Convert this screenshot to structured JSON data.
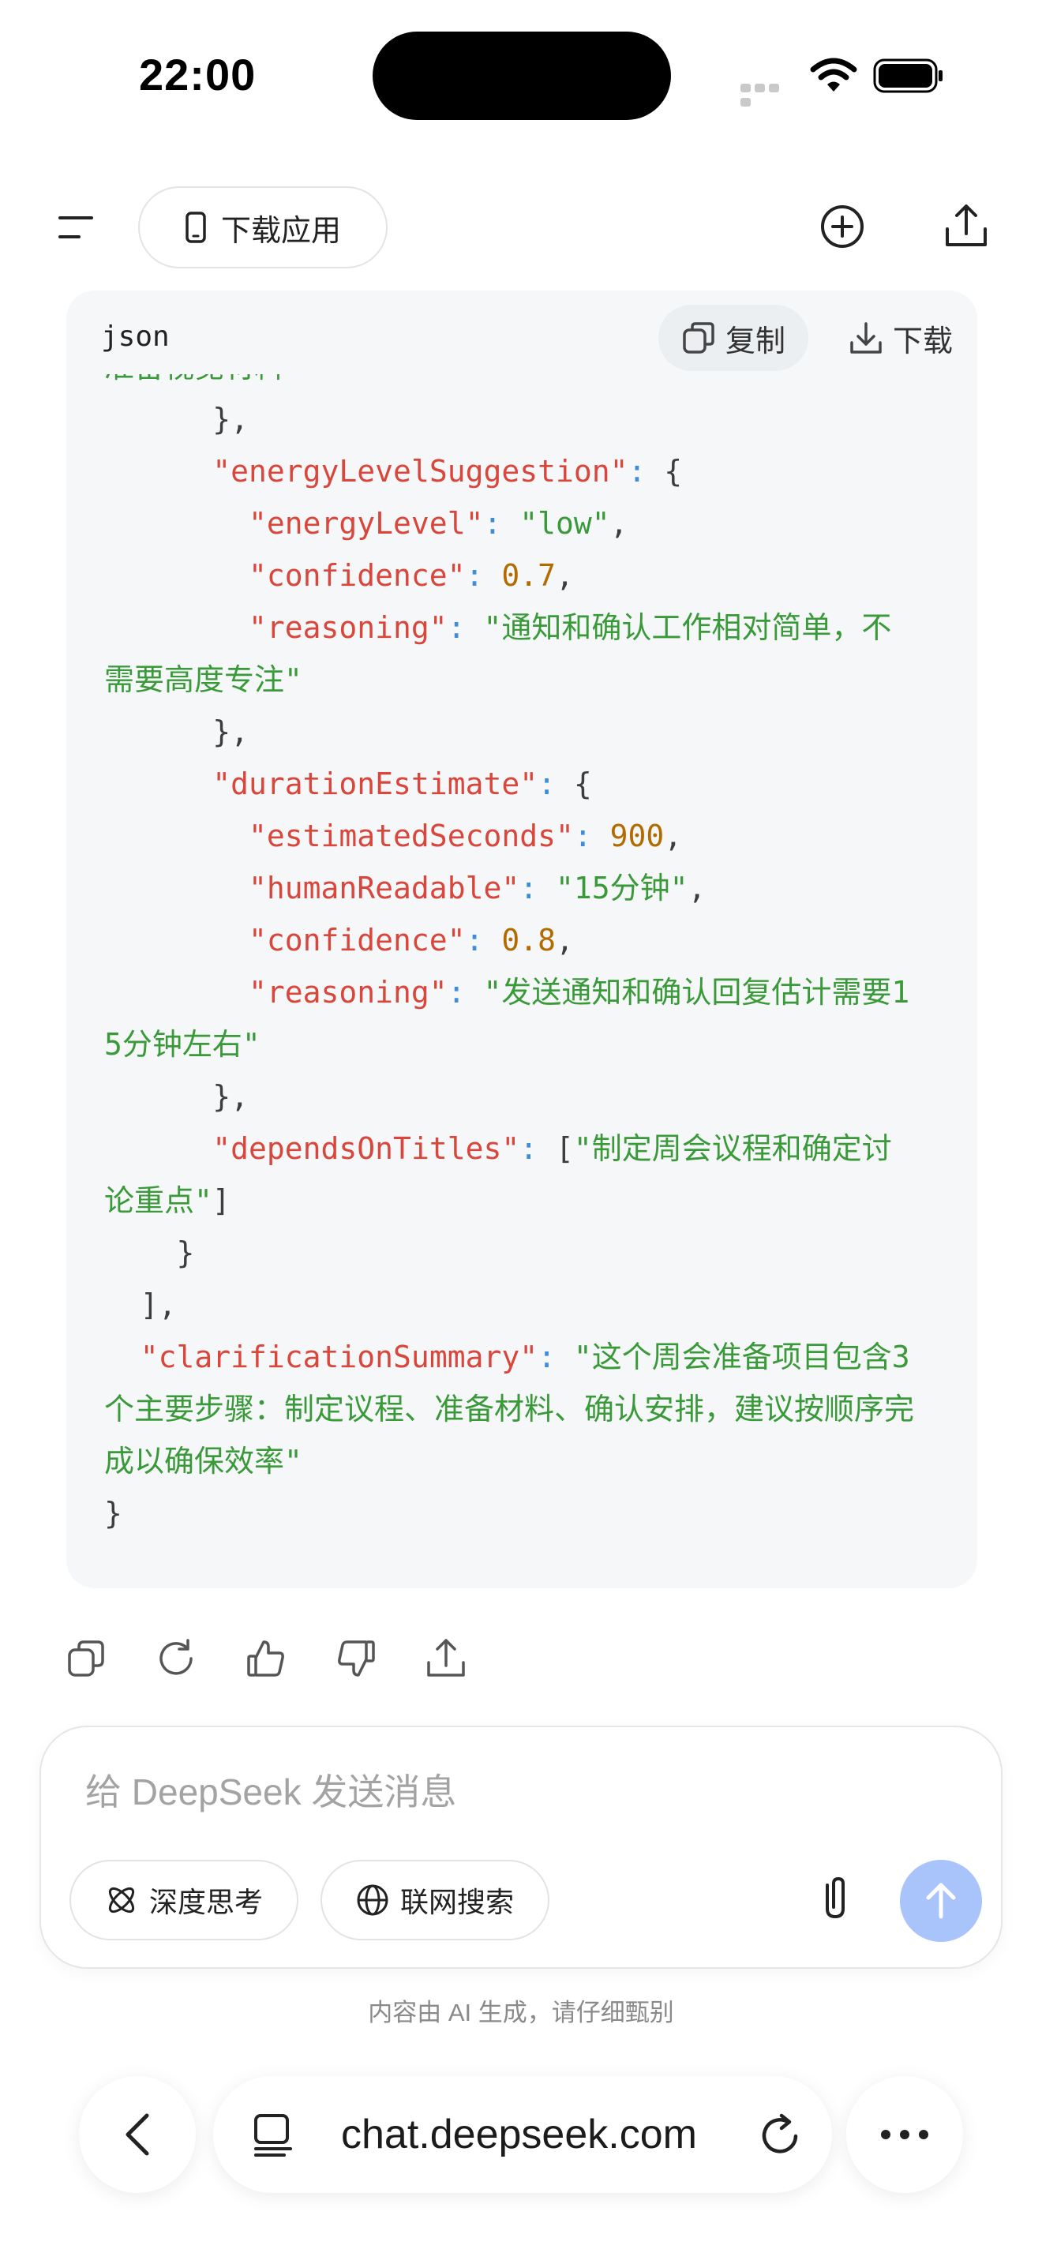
{
  "status_bar": {
    "time": "22:00"
  },
  "top_bar": {
    "download_app_label": "下载应用"
  },
  "code_block": {
    "language": "json",
    "copy_label": "复制",
    "download_label": "下载",
    "lines": [
      [
        {
          "t": "准备视觉材料",
          "c": "s"
        }
      ],
      [
        {
          "t": "      },",
          "c": "p"
        }
      ],
      [
        {
          "t": "      ",
          "c": "p"
        },
        {
          "t": "\"energyLevelSuggestion\"",
          "c": "k"
        },
        {
          "t": ": ",
          "c": "c"
        },
        {
          "t": "{",
          "c": "p"
        }
      ],
      [
        {
          "t": "        ",
          "c": "p"
        },
        {
          "t": "\"energyLevel\"",
          "c": "k"
        },
        {
          "t": ": ",
          "c": "c"
        },
        {
          "t": "\"low\"",
          "c": "s"
        },
        {
          "t": ",",
          "c": "p"
        }
      ],
      [
        {
          "t": "        ",
          "c": "p"
        },
        {
          "t": "\"confidence\"",
          "c": "k"
        },
        {
          "t": ": ",
          "c": "c"
        },
        {
          "t": "0.7",
          "c": "n"
        },
        {
          "t": ",",
          "c": "p"
        }
      ],
      [
        {
          "t": "        ",
          "c": "p"
        },
        {
          "t": "\"reasoning\"",
          "c": "k"
        },
        {
          "t": ": ",
          "c": "c"
        },
        {
          "t": "\"通知和确认工作相对简单，不",
          "c": "s"
        }
      ],
      [
        {
          "t": "需要高度专注\"",
          "c": "s"
        }
      ],
      [
        {
          "t": "      },",
          "c": "p"
        }
      ],
      [
        {
          "t": "      ",
          "c": "p"
        },
        {
          "t": "\"durationEstimate\"",
          "c": "k"
        },
        {
          "t": ": ",
          "c": "c"
        },
        {
          "t": "{",
          "c": "p"
        }
      ],
      [
        {
          "t": "        ",
          "c": "p"
        },
        {
          "t": "\"estimatedSeconds\"",
          "c": "k"
        },
        {
          "t": ": ",
          "c": "c"
        },
        {
          "t": "900",
          "c": "n"
        },
        {
          "t": ",",
          "c": "p"
        }
      ],
      [
        {
          "t": "        ",
          "c": "p"
        },
        {
          "t": "\"humanReadable\"",
          "c": "k"
        },
        {
          "t": ": ",
          "c": "c"
        },
        {
          "t": "\"15分钟\"",
          "c": "s"
        },
        {
          "t": ",",
          "c": "p"
        }
      ],
      [
        {
          "t": "        ",
          "c": "p"
        },
        {
          "t": "\"confidence\"",
          "c": "k"
        },
        {
          "t": ": ",
          "c": "c"
        },
        {
          "t": "0.8",
          "c": "n"
        },
        {
          "t": ",",
          "c": "p"
        }
      ],
      [
        {
          "t": "        ",
          "c": "p"
        },
        {
          "t": "\"reasoning\"",
          "c": "k"
        },
        {
          "t": ": ",
          "c": "c"
        },
        {
          "t": "\"发送通知和确认回复估计需要1",
          "c": "s"
        }
      ],
      [
        {
          "t": "5分钟左右\"",
          "c": "s"
        }
      ],
      [
        {
          "t": "      },",
          "c": "p"
        }
      ],
      [
        {
          "t": "      ",
          "c": "p"
        },
        {
          "t": "\"dependsOnTitles\"",
          "c": "k"
        },
        {
          "t": ": ",
          "c": "c"
        },
        {
          "t": "[",
          "c": "p"
        },
        {
          "t": "\"制定周会议程和确定讨",
          "c": "s"
        }
      ],
      [
        {
          "t": "论重点\"",
          "c": "s"
        },
        {
          "t": "]",
          "c": "p"
        }
      ],
      [
        {
          "t": "    }",
          "c": "p"
        }
      ],
      [
        {
          "t": "  ],",
          "c": "p"
        }
      ],
      [
        {
          "t": "  ",
          "c": "p"
        },
        {
          "t": "\"clarificationSummary\"",
          "c": "k"
        },
        {
          "t": ": ",
          "c": "c"
        },
        {
          "t": "\"这个周会准备项目包含3",
          "c": "s"
        }
      ],
      [
        {
          "t": "个主要步骤：制定议程、准备材料、确认安排，建议按顺序完",
          "c": "s"
        }
      ],
      [
        {
          "t": "成以确保效率\"",
          "c": "s"
        }
      ],
      [
        {
          "t": "}",
          "c": "p"
        }
      ]
    ]
  },
  "composer": {
    "placeholder": "给 DeepSeek 发送消息",
    "deep_think_label": "深度思考",
    "web_search_label": "联网搜索"
  },
  "disclaimer": "内容由 AI 生成，请仔细甄别",
  "browser": {
    "url": "chat.deepseek.com"
  },
  "colors": {
    "key": "#d9463b",
    "string": "#3a9a3a",
    "number": "#b36b00",
    "send_button": "#a9c3fb"
  }
}
